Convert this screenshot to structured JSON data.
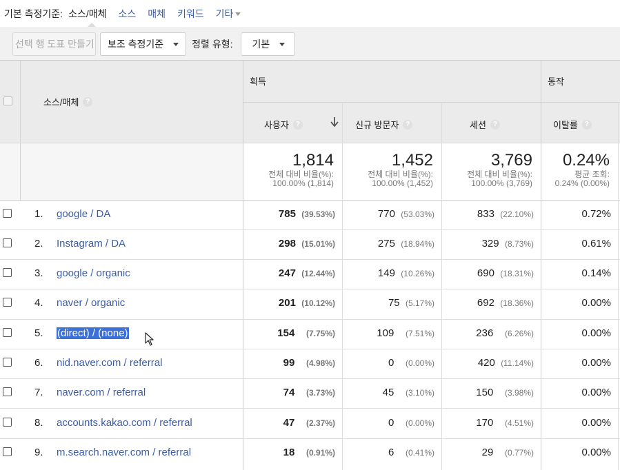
{
  "primary_dimension": {
    "label": "기본 측정기준:",
    "items": [
      {
        "label": "소스/매체",
        "active": true
      },
      {
        "label": "소스",
        "active": false
      },
      {
        "label": "매체",
        "active": false
      },
      {
        "label": "키워드",
        "active": false
      }
    ],
    "more_label": "기타"
  },
  "toolbar": {
    "plot_rows_label": "선택 행 도표 만들기",
    "secondary_dimension_label": "보조 측정기준",
    "sort_type_label": "정렬 유형:",
    "sort_type_value": "기본"
  },
  "table": {
    "dimension_header": "소스/매체",
    "groups": {
      "acquisition": "획득",
      "behavior": "동작"
    },
    "columns": {
      "users": "사용자",
      "new_users": "신규 방문자",
      "sessions": "세션",
      "bounce_rate": "이탈률"
    },
    "totals": {
      "users": {
        "value": "1,814",
        "line1": "전체 대비 비율(%):",
        "line2": "100.00% (1,814)"
      },
      "new_users": {
        "value": "1,452",
        "line1": "전체 대비 비율(%):",
        "line2": "100.00% (1,452)"
      },
      "sessions": {
        "value": "3,769",
        "line1": "전체 대비 비율(%):",
        "line2": "100.00% (3,769)"
      },
      "bounce_rate": {
        "value": "0.24%",
        "line1": "평균 조회:",
        "line2": "0.24% (0.00%)"
      }
    },
    "rows": [
      {
        "num": "1.",
        "source": "google / DA",
        "users": "785",
        "users_pct": "(39.53%)",
        "new_users": "770",
        "new_users_pct": "(53.03%)",
        "sessions": "833",
        "sessions_pct": "(22.10%)",
        "bounce": "0.72%"
      },
      {
        "num": "2.",
        "source": "Instagram / DA",
        "users": "298",
        "users_pct": "(15.01%)",
        "new_users": "275",
        "new_users_pct": "(18.94%)",
        "sessions": "329",
        "sessions_pct": "(8.73%)",
        "bounce": "0.61%"
      },
      {
        "num": "3.",
        "source": "google / organic",
        "users": "247",
        "users_pct": "(12.44%)",
        "new_users": "149",
        "new_users_pct": "(10.26%)",
        "sessions": "690",
        "sessions_pct": "(18.31%)",
        "bounce": "0.14%"
      },
      {
        "num": "4.",
        "source": "naver / organic",
        "users": "201",
        "users_pct": "(10.12%)",
        "new_users": "75",
        "new_users_pct": "(5.17%)",
        "sessions": "692",
        "sessions_pct": "(18.36%)",
        "bounce": "0.00%"
      },
      {
        "num": "5.",
        "source": "(direct) / (none)",
        "users": "154",
        "users_pct": "(7.75%)",
        "new_users": "109",
        "new_users_pct": "(7.51%)",
        "sessions": "236",
        "sessions_pct": "(6.26%)",
        "bounce": "0.00%",
        "selected": true
      },
      {
        "num": "6.",
        "source": "nid.naver.com / referral",
        "users": "99",
        "users_pct": "(4.98%)",
        "new_users": "0",
        "new_users_pct": "(0.00%)",
        "sessions": "420",
        "sessions_pct": "(11.14%)",
        "bounce": "0.00%"
      },
      {
        "num": "7.",
        "source": "naver.com / referral",
        "users": "74",
        "users_pct": "(3.73%)",
        "new_users": "45",
        "new_users_pct": "(3.10%)",
        "sessions": "150",
        "sessions_pct": "(3.98%)",
        "bounce": "0.00%"
      },
      {
        "num": "8.",
        "source": "accounts.kakao.com / referral",
        "users": "47",
        "users_pct": "(2.37%)",
        "new_users": "0",
        "new_users_pct": "(0.00%)",
        "sessions": "170",
        "sessions_pct": "(4.51%)",
        "bounce": "0.00%"
      },
      {
        "num": "9.",
        "source": "m.search.naver.com / referral",
        "users": "18",
        "users_pct": "(0.91%)",
        "new_users": "6",
        "new_users_pct": "(0.41%)",
        "sessions": "29",
        "sessions_pct": "(0.77%)",
        "bounce": "0.00%"
      }
    ]
  },
  "icons": {
    "help": "help-icon",
    "sort": "sort-desc-arrow-icon",
    "caret": "caret-down-icon",
    "cursor": "mouse-pointer-icon"
  },
  "colors": {
    "link": "#3b5da8",
    "selection": "#3b6fd9",
    "header_bg": "#ebebeb",
    "toolbar_bg": "#f1f1f1"
  }
}
